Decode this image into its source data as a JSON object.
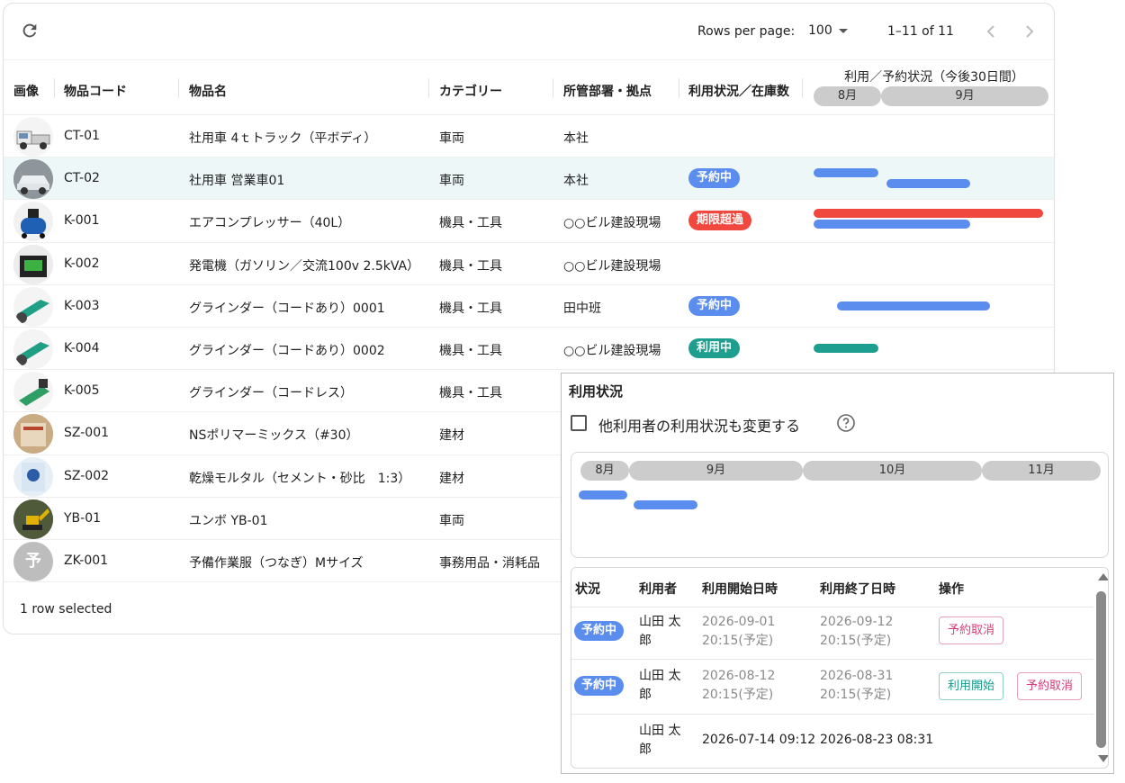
{
  "toolbar": {
    "rows_per_page_label": "Rows per page:",
    "rows_per_page_value": "100",
    "range": "1–11 of 11",
    "icons": {
      "refresh": "refresh-icon",
      "prev": "chevron-left-icon",
      "next": "chevron-right-icon"
    }
  },
  "columns": {
    "image": "画像",
    "code": "物品コード",
    "name": "物品名",
    "category": "カテゴリー",
    "department": "所管部署・拠点",
    "status": "利用状況／在庫数",
    "schedule": "利用／予約状況（今後30日間）"
  },
  "gantt_months": [
    "8月",
    "9月"
  ],
  "rows": [
    {
      "code": "CT-01",
      "name": "社用車 4ｔトラック（平ボディ）",
      "category": "車両",
      "department": "本社",
      "status": "",
      "thumb": "truck"
    },
    {
      "code": "CT-02",
      "name": "社用車 営業車01",
      "category": "車両",
      "department": "本社",
      "status": "予約中",
      "thumb": "car"
    },
    {
      "code": "K-001",
      "name": "エアコンプレッサー（40L）",
      "category": "機具・工具",
      "department": "○○ビル建設現場",
      "status": "期限超過",
      "thumb": "compressor"
    },
    {
      "code": "K-002",
      "name": "発電機（ガソリン／交流100v 2.5kVA）",
      "category": "機具・工具",
      "department": "○○ビル建設現場",
      "status": "",
      "thumb": "generator"
    },
    {
      "code": "K-003",
      "name": "グラインダー（コードあり）0001",
      "category": "機具・工具",
      "department": "田中班",
      "status": "予約中",
      "thumb": "grinder"
    },
    {
      "code": "K-004",
      "name": "グラインダー（コードあり）0002",
      "category": "機具・工具",
      "department": "○○ビル建設現場",
      "status": "利用中",
      "thumb": "grinder"
    },
    {
      "code": "K-005",
      "name": "グラインダー（コードレス）",
      "category": "機具・工具",
      "department": "",
      "status": "",
      "thumb": "grinder2"
    },
    {
      "code": "SZ-001",
      "name": "NSポリマーミックス（#30）",
      "category": "建材",
      "department": "",
      "status": "",
      "thumb": "bag"
    },
    {
      "code": "SZ-002",
      "name": "乾燥モルタル（セメント・砂比　1:3）",
      "category": "建材",
      "department": "",
      "status": "",
      "thumb": "bag2"
    },
    {
      "code": "YB-01",
      "name": "ユンボ YB-01",
      "category": "車両",
      "department": "",
      "status": "",
      "thumb": "excavator"
    },
    {
      "code": "ZK-001",
      "name": "予備作業服（つなぎ）Mサイズ",
      "category": "事務用品・消耗品",
      "department": "",
      "status": "",
      "thumb": "letter",
      "initial": "予"
    }
  ],
  "footer": {
    "selected": "1 row selected"
  },
  "colors": {
    "reserved": "#5b8def",
    "overdue": "#f0483e",
    "in_use": "#1e9e8e",
    "selected_row": "#eef7f8"
  },
  "popup": {
    "title": "利用状況",
    "checkbox_label": "他利用者の利用状況も変更する",
    "help_icon": "help-circle-icon",
    "months": [
      "8月",
      "9月",
      "10月",
      "11月"
    ],
    "table_headers": [
      "状況",
      "利用者",
      "利用開始日時",
      "利用終了日時",
      "操作"
    ],
    "records": [
      {
        "status": "予約中",
        "user": "山田 太郎",
        "start": "2026-09-01 20:15(予定)",
        "end": "2026-09-12 20:15(予定)",
        "actions": [
          "予約取消"
        ]
      },
      {
        "status": "予約中",
        "user": "山田 太郎",
        "start": "2026-08-12 20:15(予定)",
        "end": "2026-08-31 20:15(予定)",
        "actions": [
          "利用開始",
          "予約取消"
        ]
      },
      {
        "status": "",
        "user": "山田 太郎",
        "start": "2026-07-14 09:12",
        "end": "2026-08-23 08:31",
        "actions": []
      }
    ]
  }
}
